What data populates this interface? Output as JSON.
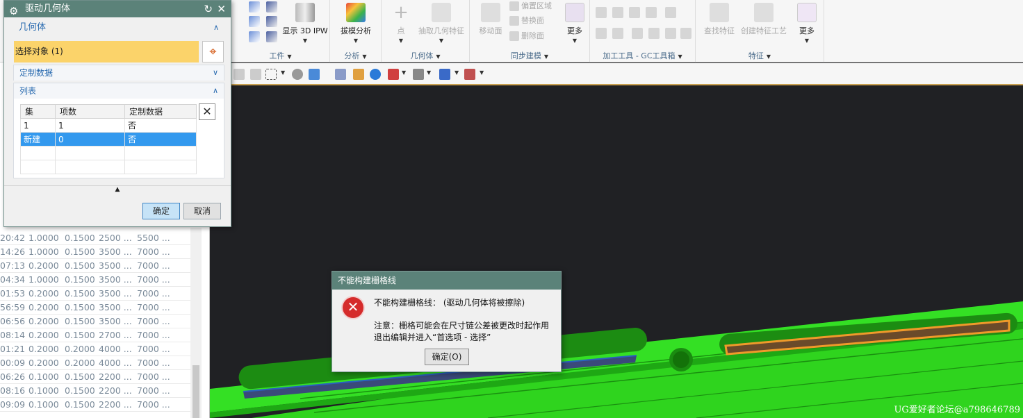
{
  "ribbon": {
    "ipw_label": "显示 3D IPW",
    "draft_label": "拔模分析",
    "point_label": "点",
    "extract_label": "抽取几何特征",
    "move_face_label": "移动面",
    "offset_region": "偏置区域",
    "replace_face": "替换面",
    "delete_face": "删除面",
    "more1": "更多",
    "find_feature": "查找特征",
    "create_feature_process": "创建特征工艺",
    "more2": "更多",
    "groups": {
      "workpiece": "工件",
      "analysis": "分析",
      "geometry": "几何体",
      "sync": "同步建模",
      "tools": "加工工具 - GC工具箱",
      "feature": "特征"
    }
  },
  "leftlist": {
    "rows": [
      [
        "20:42",
        "1.0000",
        "0.1500",
        "2500 ...",
        "5500 ..."
      ],
      [
        "14:26",
        "1.0000",
        "0.1500",
        "3500 ...",
        "7000 ..."
      ],
      [
        "07:13",
        "0.2000",
        "0.1500",
        "3500 ...",
        "7000 ..."
      ],
      [
        "04:34",
        "1.0000",
        "0.1500",
        "3500 ...",
        "7000 ..."
      ],
      [
        "01:53",
        "0.2000",
        "0.1500",
        "3500 ...",
        "7000 ..."
      ],
      [
        "56:59",
        "0.2000",
        "0.1500",
        "3500 ...",
        "7000 ..."
      ],
      [
        "06:56",
        "0.2000",
        "0.1500",
        "3500 ...",
        "7000 ..."
      ],
      [
        "08:14",
        "0.2000",
        "0.1500",
        "2700 ...",
        "7000 ..."
      ],
      [
        "01:21",
        "0.2000",
        "0.2000",
        "4000 ...",
        "7000 ..."
      ],
      [
        "00:09",
        "0.2000",
        "0.2000",
        "4000 ...",
        "7000 ..."
      ],
      [
        "06:26",
        "0.1000",
        "0.1500",
        "2200 ...",
        "7000 ..."
      ],
      [
        "08:16",
        "0.1000",
        "0.1500",
        "2200 ...",
        "7000 ..."
      ],
      [
        "09:09",
        "0.1000",
        "0.1500",
        "2200 ...",
        "7000 ..."
      ]
    ]
  },
  "dialog": {
    "title": "驱动几何体",
    "geometry_section": "几何体",
    "select_object": "选择对象 (1)",
    "custom_data_section": "定制数据",
    "list_section": "列表",
    "table": {
      "headers": [
        "集",
        "项数",
        "定制数据"
      ],
      "rows": [
        [
          "1",
          "1",
          "否"
        ],
        [
          "新建",
          "0",
          "否"
        ]
      ]
    },
    "ok": "确定",
    "cancel": "取消"
  },
  "error": {
    "title": "不能构建栅格线",
    "line1": "不能构建栅格线： (驱动几何体将被擦除)",
    "line2": "注意：栅格可能会在尺寸链公差被更改时起作用",
    "line3": "退出编辑并进入“首选项 - 选择”",
    "ok": "确定(O)"
  },
  "watermark": "UG爱好者论坛@a798646789",
  "colors": {
    "titlebar": "#5b8279",
    "selection_yellow": "#fbd36a",
    "table_selected": "#3399ee",
    "model_green": "#27d21a",
    "error_red": "#d52b2b"
  }
}
